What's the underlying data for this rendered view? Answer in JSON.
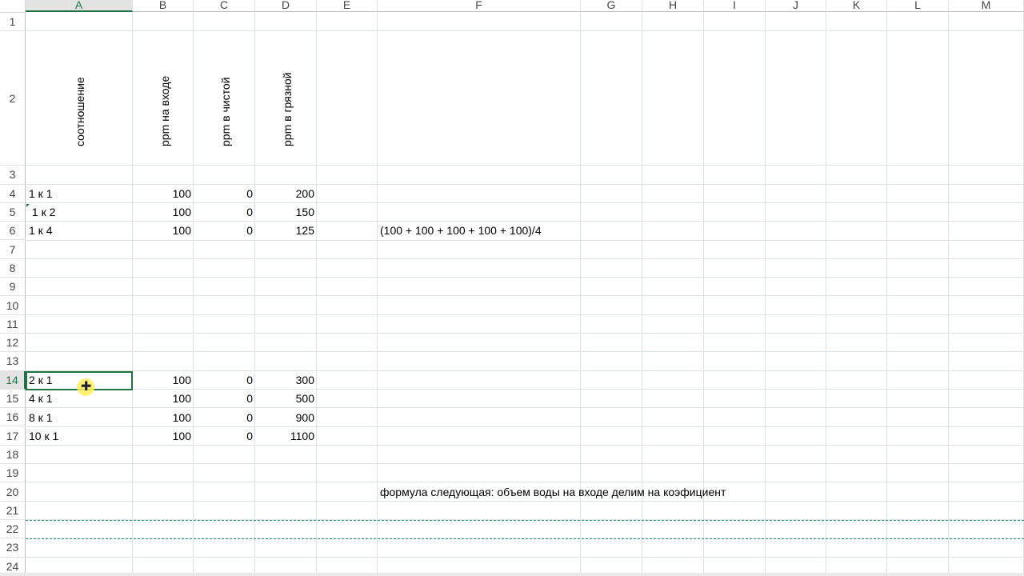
{
  "columns": [
    "A",
    "B",
    "C",
    "D",
    "E",
    "F",
    "G",
    "H",
    "I",
    "J",
    "K",
    "L",
    "M"
  ],
  "rows": [
    "1",
    "2",
    "3",
    "4",
    "5",
    "6",
    "7",
    "8",
    "9",
    "10",
    "11",
    "12",
    "13",
    "14",
    "15",
    "16",
    "17",
    "18",
    "19",
    "20",
    "21",
    "22",
    "23",
    "24"
  ],
  "active_column": "A",
  "active_row": "14",
  "headers": {
    "a2": "соотношение",
    "b2": "ppm на входе",
    "c2": "ppm в чистой",
    "d2": "ppm в грязной"
  },
  "table1": [
    {
      "a": "1 к 1",
      "b": "100",
      "c": "0",
      "d": "200"
    },
    {
      "a": " 1 к 2",
      "b": "100",
      "c": "0",
      "d": "150"
    },
    {
      "a": "1 к 4",
      "b": "100",
      "c": "0",
      "d": "125"
    }
  ],
  "f6": "(100 + 100 + 100 + 100 + 100)/4",
  "table2": [
    {
      "a": "2 к 1",
      "b": "100",
      "c": "0",
      "d": "300"
    },
    {
      "a": "4 к 1",
      "b": "100",
      "c": "0",
      "d": "500"
    },
    {
      "a": "8 к 1",
      "b": "100",
      "c": "0",
      "d": "900"
    },
    {
      "a": "10 к 1",
      "b": "100",
      "c": "0",
      "d": "1100"
    }
  ],
  "f20": "формула следующая: объем воды на входе делим на коэфициент",
  "colors": {
    "accent": "#217346",
    "gridline": "#d9e1ea",
    "copy_marquee": "#2a9a6b",
    "cursor_highlight": "#ffef5a"
  },
  "cursor_icon": "cell-select-plus-icon"
}
